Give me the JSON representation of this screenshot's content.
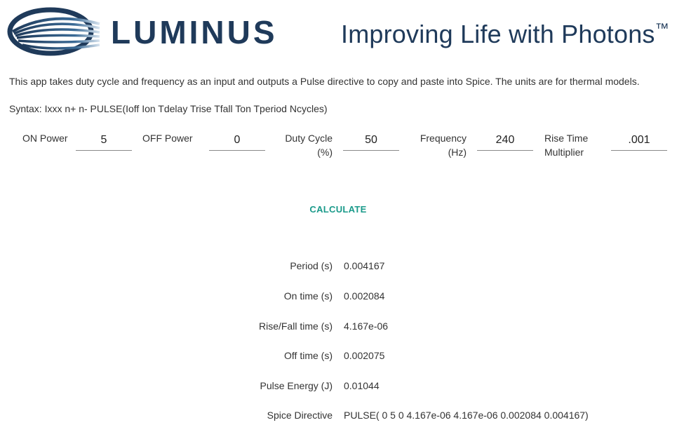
{
  "header": {
    "logo_text": "LUMINUS",
    "tagline": "Improving Life with Photons",
    "tagline_mark": "™",
    "brand_color": "#1f3a5a"
  },
  "description": "This app takes duty cycle and frequency as an input and outputs a Pulse directive to copy and paste into Spice. The units are for thermal models.",
  "syntax": "Syntax: Ixxx n+ n- PULSE(Ioff Ion Tdelay Trise Tfall Ton Tperiod Ncycles)",
  "inputs": [
    {
      "label_line1": "ON Power",
      "label_line2": "",
      "value": "5"
    },
    {
      "label_line1": "OFF Power",
      "label_line2": "",
      "value": "0"
    },
    {
      "label_line1": "Duty Cycle",
      "label_line2": "(%)",
      "value": "50"
    },
    {
      "label_line1": "Frequency",
      "label_line2": "(Hz)",
      "value": "240"
    },
    {
      "label_line1": "Rise Time",
      "label_line2": "Multiplier",
      "value": ".001"
    }
  ],
  "calculate_label": "CALCULATE",
  "accent_color": "#1a9a8a",
  "results": [
    {
      "label": "Period (s)",
      "value": "0.004167"
    },
    {
      "label": "On time (s)",
      "value": "0.002084"
    },
    {
      "label": "Rise/Fall time (s)",
      "value": "4.167e-06"
    },
    {
      "label": "Off time (s)",
      "value": "0.002075"
    },
    {
      "label": "Pulse Energy (J)",
      "value": "0.01044"
    },
    {
      "label": "Spice Directive",
      "value": "PULSE( 0 5 0 4.167e-06 4.167e-06 0.002084 0.004167)"
    }
  ]
}
